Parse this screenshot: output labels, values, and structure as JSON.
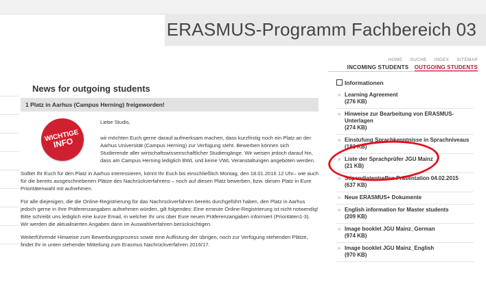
{
  "header": {
    "title": "ERASMUS-Programm Fachbereich 03"
  },
  "util_nav": [
    "HOME",
    "SUCHE",
    "INDEX",
    "SITEMAP"
  ],
  "main_nav": {
    "incoming": "INCOMING STUDENTS",
    "outgoing": "OUTGOING STUDENTS"
  },
  "content": {
    "title": "News for outgoing students",
    "article_heading": "1 Platz in Aarhus (Campus Herning) freigeworden!",
    "badge_line1": "WICHTIGE",
    "badge_line2": "INFO",
    "greeting": "Liebe Studis,",
    "p1": "wir möchten Euch gerne darauf aufmerksam machen, dass kurzfristig noch ein Platz an der Aarhus Universität (Campus Herning) zur Verfügung steht. Bewerben können sich Studierende aller wirtschaftswissenschaftlicher Studiengänge. Wir weisen jedoch darauf hin, dass am Campus Herning lediglich BWL und keine VWL Veranstaltungen angeboten werden.",
    "p2": "Solltet Ihr Euch für den Platz in Aarhus interessieren, könnt Ihr Euch bis einschließlich Montag, den 18.01.2016 12 Uhr– wie auch für die bereits ausgeschriebenen Plätze des Nachrückverfahrens – noch auf diesen Platz bewerben, bzw. diesen Platz in Eure Prioritätenwahl mit aufnehmen.",
    "p3": "Für alle diejenigen, die die Online-Registrierung für das Nachrückverfahren bereits durchgeführt haben, den Platz in Aarhus jedoch gerne in Ihre Präferenzangaben aufnehmen würden, gilt folgendes: Eine erneute Online-Registrierung ist nicht notwendig! Bitte schreibt uns lediglich eine kurze Email, in welcher Ihr uns über Eure neuen Präferenzangaben informiert (Prioritäten1-3). Wir werden die aktualisierten Angaben dann im Auswahlverfahren berücksichtigen.",
    "p4": "Weiterführende Hinweise zum Bewerbungsprozess sowie eine Auflistung der übrigen, noch zur Verfügung stehenden Plätze, findet Ihr in unten stehender Mitteilung zum Erasmus Nachrückverfahren 2016/17."
  },
  "sidebar": {
    "title": "Informationen",
    "items": [
      {
        "label": "Learning Agreement",
        "size": "(276 KB)"
      },
      {
        "label": "Hinweise zur Bearbeitung von ERASMUS-Unterlagen",
        "size": "(274 KB)"
      },
      {
        "label": "Einstufung Sprachkenntnisse in Sprachniveaus",
        "size": "(183 KB)"
      },
      {
        "label": "Liste der Sprachprüfer JGU Mainz",
        "size": "(21 KB)"
      },
      {
        "label": "Stipendiatentreffen Präsentation 04.02.2015",
        "size": "(637 KB)"
      },
      {
        "label": "Neue ERASMUS+ Dokumente",
        "size": ""
      },
      {
        "label": "English information for Master students",
        "size": "(209 KB)"
      },
      {
        "label": "Image booklet JGU Mainz_German",
        "size": "(974 KB)"
      },
      {
        "label": "Image booklet JGU Mainz_English",
        "size": "(970 KB)"
      }
    ]
  },
  "colors": {
    "accent": "#c0122c",
    "highlight": "#e3101d",
    "header_bg": "#e9e9e9"
  }
}
